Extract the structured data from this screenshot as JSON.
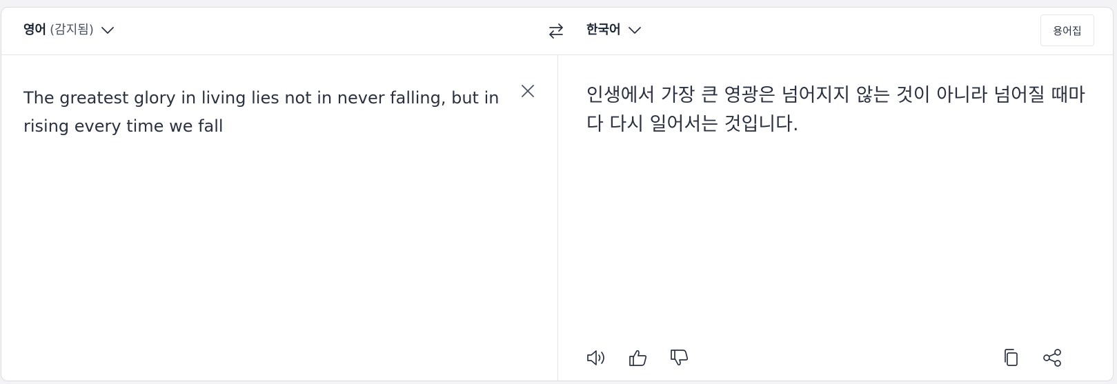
{
  "header": {
    "source_lang": {
      "name": "영어",
      "detected": "(감지됨)",
      "icon": "chevron-down-icon"
    },
    "swap_icon": "swap-arrows-icon",
    "target_lang": {
      "name": "한국어",
      "icon": "chevron-down-icon"
    },
    "glossary_label": "용어집"
  },
  "source": {
    "text": "The greatest glory in living lies not in never falling, but in rising every time we fall",
    "clear_icon": "close-icon"
  },
  "target": {
    "text": "인생에서 가장 큰 영광은 넘어지지 않는 것이 아니라 넘어질 때마다 다시 일어서는 것입니다.",
    "actions": {
      "listen": "speaker-icon",
      "like": "thumbs-up-icon",
      "dislike": "thumbs-down-icon",
      "copy": "copy-icon",
      "share": "share-icon"
    }
  },
  "colors": {
    "text": "#222a38",
    "border": "#e3e4e8",
    "background": "#ffffff"
  }
}
